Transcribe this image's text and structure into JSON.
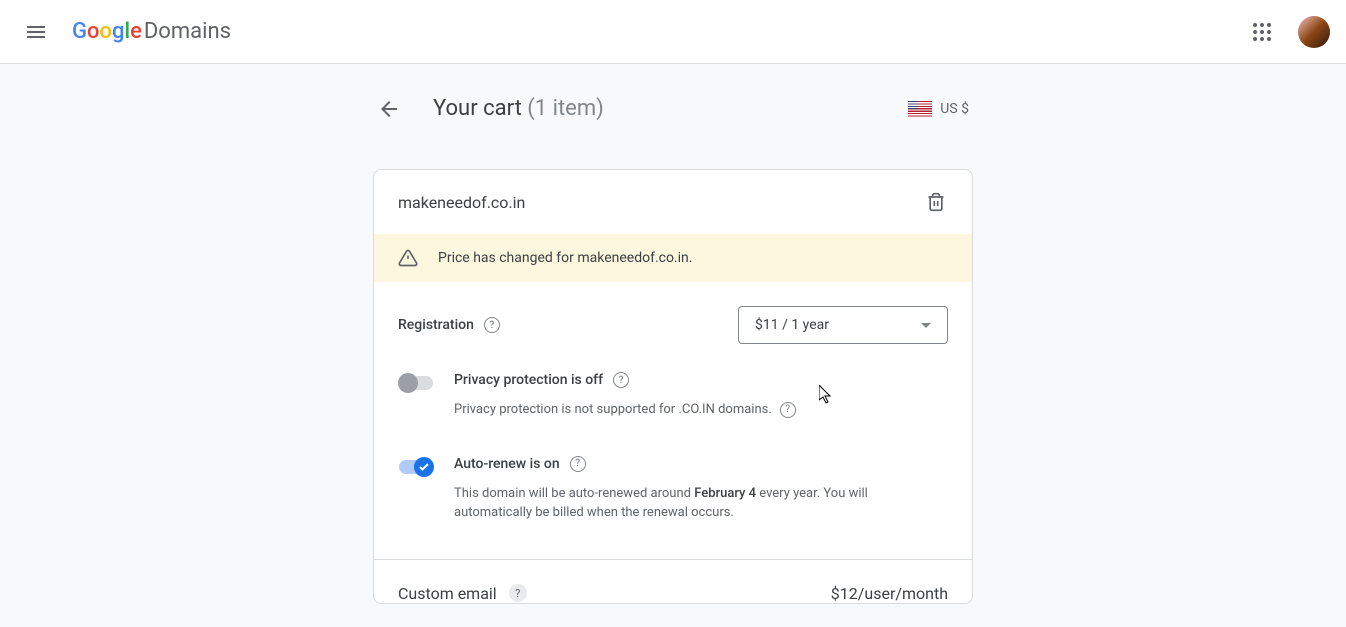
{
  "header": {
    "product": "Domains"
  },
  "page": {
    "title": "Your cart",
    "item_count": "(1 item)",
    "currency": "US $"
  },
  "domain": {
    "name": "makeneedof.co.in",
    "warning": "Price has changed for makeneedof.co.in."
  },
  "registration": {
    "label": "Registration",
    "option": "$11 / 1 year"
  },
  "privacy": {
    "label": "Privacy protection is off",
    "desc": "Privacy protection is not supported for .CO.IN domains."
  },
  "autorenew": {
    "label": "Auto-renew is on",
    "desc_before": "This domain will be auto-renewed around ",
    "desc_date": "February 4",
    "desc_after": " every year. You will automatically be billed when the renewal occurs."
  },
  "custom_email": {
    "label": "Custom email",
    "price": "$12/user/month"
  }
}
